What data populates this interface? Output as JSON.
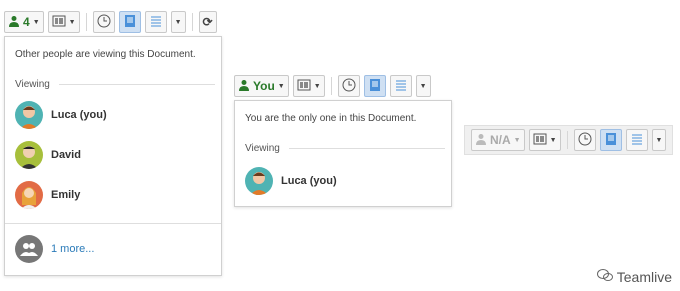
{
  "panel1": {
    "toolbar": {
      "count": "4"
    },
    "message": "Other people are viewing this Document.",
    "section": "Viewing",
    "users": [
      "Luca (you)",
      "David",
      "Emily"
    ],
    "more": "1 more..."
  },
  "panel2": {
    "toolbar": {
      "you": "You"
    },
    "message": "You are the only one in this Document.",
    "section": "Viewing",
    "users": [
      "Luca (you)"
    ]
  },
  "panel3": {
    "toolbar": {
      "na": "N/A"
    }
  },
  "watermark": "Teamlive",
  "colors": {
    "green": "#2a7a2a",
    "link": "#2b7bb9"
  },
  "icons": [
    "user-icon",
    "layout-icon",
    "history-icon",
    "document-icon",
    "list-icon",
    "refresh-icon",
    "group-icon"
  ]
}
